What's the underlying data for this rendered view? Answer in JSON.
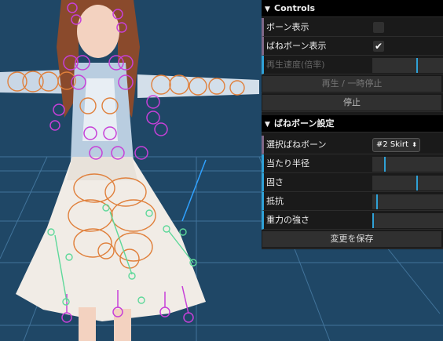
{
  "controls": {
    "title": "Controls",
    "bone_display": {
      "label": "ボーン表示",
      "checked": false
    },
    "spring_bone_display": {
      "label": "ばねボーン表示",
      "checked": true,
      "mark": "✔"
    },
    "playback_speed": {
      "label": "再生速度(倍率)",
      "fraction": 0.62
    },
    "play_pause": {
      "label": "再生 / 一時停止"
    },
    "stop": {
      "label": "停止"
    }
  },
  "spring_settings": {
    "title": "ばねボーン設定",
    "select_bone": {
      "label": "選択ばねボーン",
      "value": "#2 Skirt",
      "caret": "⬍"
    },
    "hit_radius": {
      "label": "当たり半径",
      "fraction": 0.18
    },
    "stiffness": {
      "label": "固さ",
      "fraction": 0.62
    },
    "drag": {
      "label": "抵抗",
      "fraction": 0.08
    },
    "gravity": {
      "label": "重力の強さ",
      "fraction": 0.02
    },
    "save": {
      "label": "変更を保存"
    }
  },
  "icons": {
    "folder_open": "▼"
  },
  "colors": {
    "background": "#1f4766",
    "grid": "#4a7fa8",
    "bone_magenta": "#c740d8",
    "collider_orange": "#e0803c",
    "bone_green": "#5ed89a",
    "slider_accent": "#2fa1d6"
  }
}
